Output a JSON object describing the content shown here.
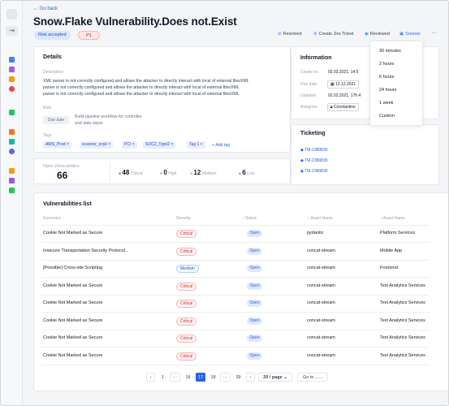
{
  "header": {
    "back_label": "Go back",
    "title": "Snow.Flake Vulnerability.Does not.Exist",
    "badge_status": "Risk accepted",
    "badge_priority": "P1",
    "actions": {
      "resolved": "Resolved",
      "create_jira": "Create Jira Ticket",
      "reviewed": "Reviewed",
      "snooze": "Snooze",
      "more": "···"
    }
  },
  "snooze_menu": {
    "options": [
      "30 minutes",
      "2 hours",
      "6 hours",
      "24 hours",
      "1 week",
      "Custom"
    ]
  },
  "details": {
    "heading": "Details",
    "description_label": "Description",
    "description_lines": [
      "XML parser is not correctly configured and allows the attacker to directly interact with local of external filesXML",
      "parser is not correctly configured and allows the attacker to directly interact with local of external filesXML",
      "parser is not correctly configured and allows the attacker to directly interact with local of external filesXML"
    ],
    "rule_label": "Rule",
    "rule_chip": "Due date",
    "rule_text_1": "Build pipeline workflow for controller",
    "rule_text_2": "and data repos",
    "tags_label": "Tags",
    "tags": [
      "AWS_Prod",
      "scanner_snyk",
      "PCI",
      "SOC2_Type2",
      "Tag 1"
    ],
    "tag_remove": "×",
    "add_tag": "+ Add tag"
  },
  "summary": {
    "open_label": "Open Vulnerabilities",
    "open_count": "66",
    "critical_count": "48",
    "critical_label": "Critical",
    "high_count": "0",
    "high_label": "High",
    "medium_count": "12",
    "medium_label": "Medium",
    "low_count": "6",
    "low_label": "Low"
  },
  "information": {
    "heading": "Information",
    "rows": [
      {
        "label": "Create on",
        "value": "02.03.2021, 14:5"
      },
      {
        "label": "Due date",
        "value": "12.12.2021"
      },
      {
        "label": "Updated",
        "value": "02.03.2021, 17h 4"
      },
      {
        "label": "Assignee",
        "value": "Constantine"
      }
    ]
  },
  "ticketing": {
    "heading": "Ticketing",
    "tickets": [
      "TM-2389839",
      "TM-2389839",
      "TM-2389839"
    ]
  },
  "vuln_list": {
    "heading": "Vulnerabilities list",
    "columns": [
      "Summary",
      "Severity",
      "↓ Status",
      "↓ Asset Name",
      "↓ Asset Name"
    ],
    "rows": [
      {
        "summary": "Cookie Not Marked as Secure",
        "severity": "Critical",
        "status": "Open",
        "asset": "pydantic",
        "asset2": "Platform Services"
      },
      {
        "summary": "Insecure Transportation Security Protocol...",
        "severity": "Critical",
        "status": "Open",
        "asset": "concat-stream",
        "asset2": "Mobile App"
      },
      {
        "summary": "[Possible] Cross-site Scripting",
        "severity": "Medium",
        "status": "Open",
        "asset": "concat-stream",
        "asset2": "Frontend"
      },
      {
        "summary": "Cookie Not Marked as Secure",
        "severity": "Critical",
        "status": "Open",
        "asset": "concat-stream",
        "asset2": "Text Analytics Services"
      },
      {
        "summary": "Cookie Not Marked as Secure",
        "severity": "Critical",
        "status": "Open",
        "asset": "concat-stream",
        "asset2": "Text Analytics Services"
      },
      {
        "summary": "Cookie Not Marked as Secure",
        "severity": "Critical",
        "status": "Open",
        "asset": "concat-stream",
        "asset2": "Text Analytics Services"
      },
      {
        "summary": "Cookie Not Marked as Secure",
        "severity": "Critical",
        "status": "Open",
        "asset": "concat-stream",
        "asset2": "Text Analytics Services"
      },
      {
        "summary": "Cookie Not Marked as Secure",
        "severity": "Critical",
        "status": "Open",
        "asset": "concat-stream",
        "asset2": "Text Analytics Services"
      }
    ]
  },
  "pagination": {
    "prev": "‹",
    "pages": [
      "1",
      "···",
      "16",
      "17",
      "18",
      "···",
      "39"
    ],
    "current": "17",
    "next": "›",
    "page_size": "20 / page",
    "goto": "Go to ......"
  },
  "colors": {
    "accent": "#2563eb",
    "critical": "#dc2626",
    "background": "#f4f5f7"
  }
}
